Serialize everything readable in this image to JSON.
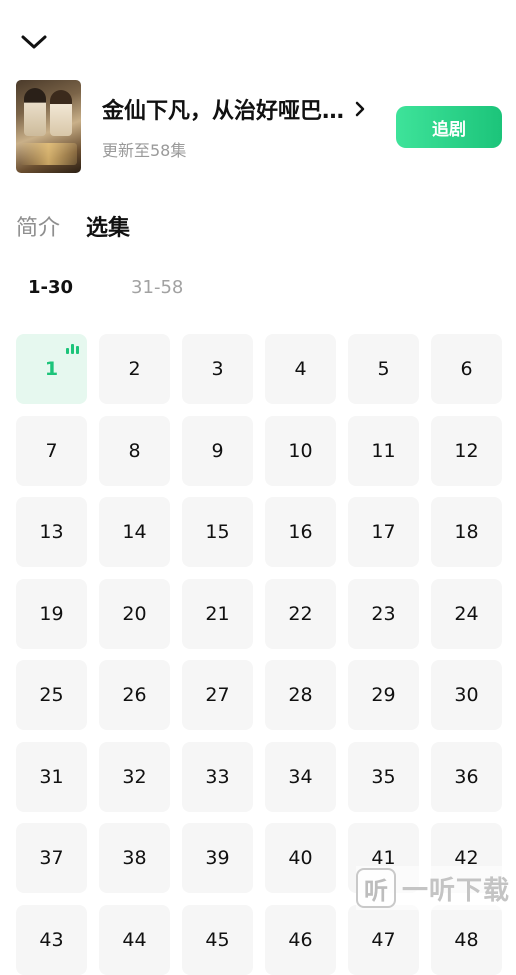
{
  "header": {
    "title": "金仙下凡，从治好哑巴…",
    "subtitle": "更新至58集",
    "follow_label": "追剧",
    "collapse_icon": "chevron-down-icon",
    "title_icon": "chevron-right-icon"
  },
  "tabs": [
    {
      "label": "简介",
      "active": false
    },
    {
      "label": "选集",
      "active": true
    }
  ],
  "ranges": [
    {
      "label": "1-30",
      "active": true
    },
    {
      "label": "31-58",
      "active": false
    }
  ],
  "episodes": [
    "1",
    "2",
    "3",
    "4",
    "5",
    "6",
    "7",
    "8",
    "9",
    "10",
    "11",
    "12",
    "13",
    "14",
    "15",
    "16",
    "17",
    "18",
    "19",
    "20",
    "21",
    "22",
    "23",
    "24",
    "25",
    "26",
    "27",
    "28",
    "29",
    "30",
    "31",
    "32",
    "33",
    "34",
    "35",
    "36",
    "37",
    "38",
    "39",
    "40",
    "41",
    "42",
    "43",
    "44",
    "45",
    "46",
    "47",
    "48"
  ],
  "current_episode": "1",
  "watermark": {
    "logo": "听",
    "text": "一听下载"
  },
  "colors": {
    "accent": "#1cc47a",
    "accent_light": "#e6f8ef",
    "tile_bg": "#f6f6f6"
  }
}
